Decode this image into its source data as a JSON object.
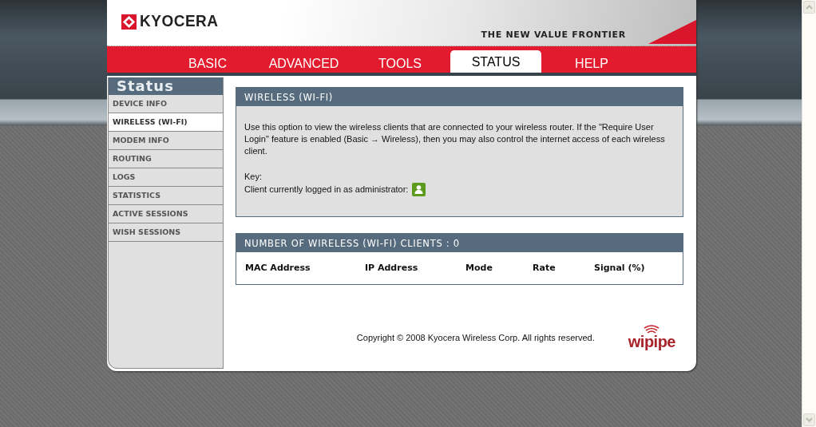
{
  "brand": {
    "name": "KYOCERA",
    "tagline": "THE NEW VALUE FRONTIER"
  },
  "tabs": [
    {
      "label": "BASIC",
      "selected": false
    },
    {
      "label": "ADVANCED",
      "selected": false
    },
    {
      "label": "TOOLS",
      "selected": false
    },
    {
      "label": "STATUS",
      "selected": true
    },
    {
      "label": "HELP",
      "selected": false
    }
  ],
  "sidebar": {
    "title": "Status",
    "items": [
      {
        "label": "DEVICE INFO",
        "selected": false
      },
      {
        "label": "WIRELESS (WI-FI)",
        "selected": true
      },
      {
        "label": "MODEM INFO",
        "selected": false
      },
      {
        "label": "ROUTING",
        "selected": false
      },
      {
        "label": "LOGS",
        "selected": false
      },
      {
        "label": "STATISTICS",
        "selected": false
      },
      {
        "label": "ACTIVE SESSIONS",
        "selected": false
      },
      {
        "label": "WISH SESSIONS",
        "selected": false
      }
    ]
  },
  "panel": {
    "title": "WIRELESS (WI-FI)",
    "description": "Use this option to view the wireless clients that are connected to your wireless router. If the \"Require User Login\" feature is enabled (Basic → Wireless), then you may also control the internet access of each wireless client.",
    "key_label": "Key:",
    "key_item": "Client currently logged in as administrator:"
  },
  "clients": {
    "title": "NUMBER OF WIRELESS (WI-FI) CLIENTS : 0",
    "columns": [
      "MAC Address",
      "IP Address",
      "Mode",
      "Rate",
      "Signal (%)"
    ]
  },
  "footer": {
    "copyright": "Copyright © 2008 Kyocera Wireless Corp. All rights reserved.",
    "logo": "wipipe"
  }
}
